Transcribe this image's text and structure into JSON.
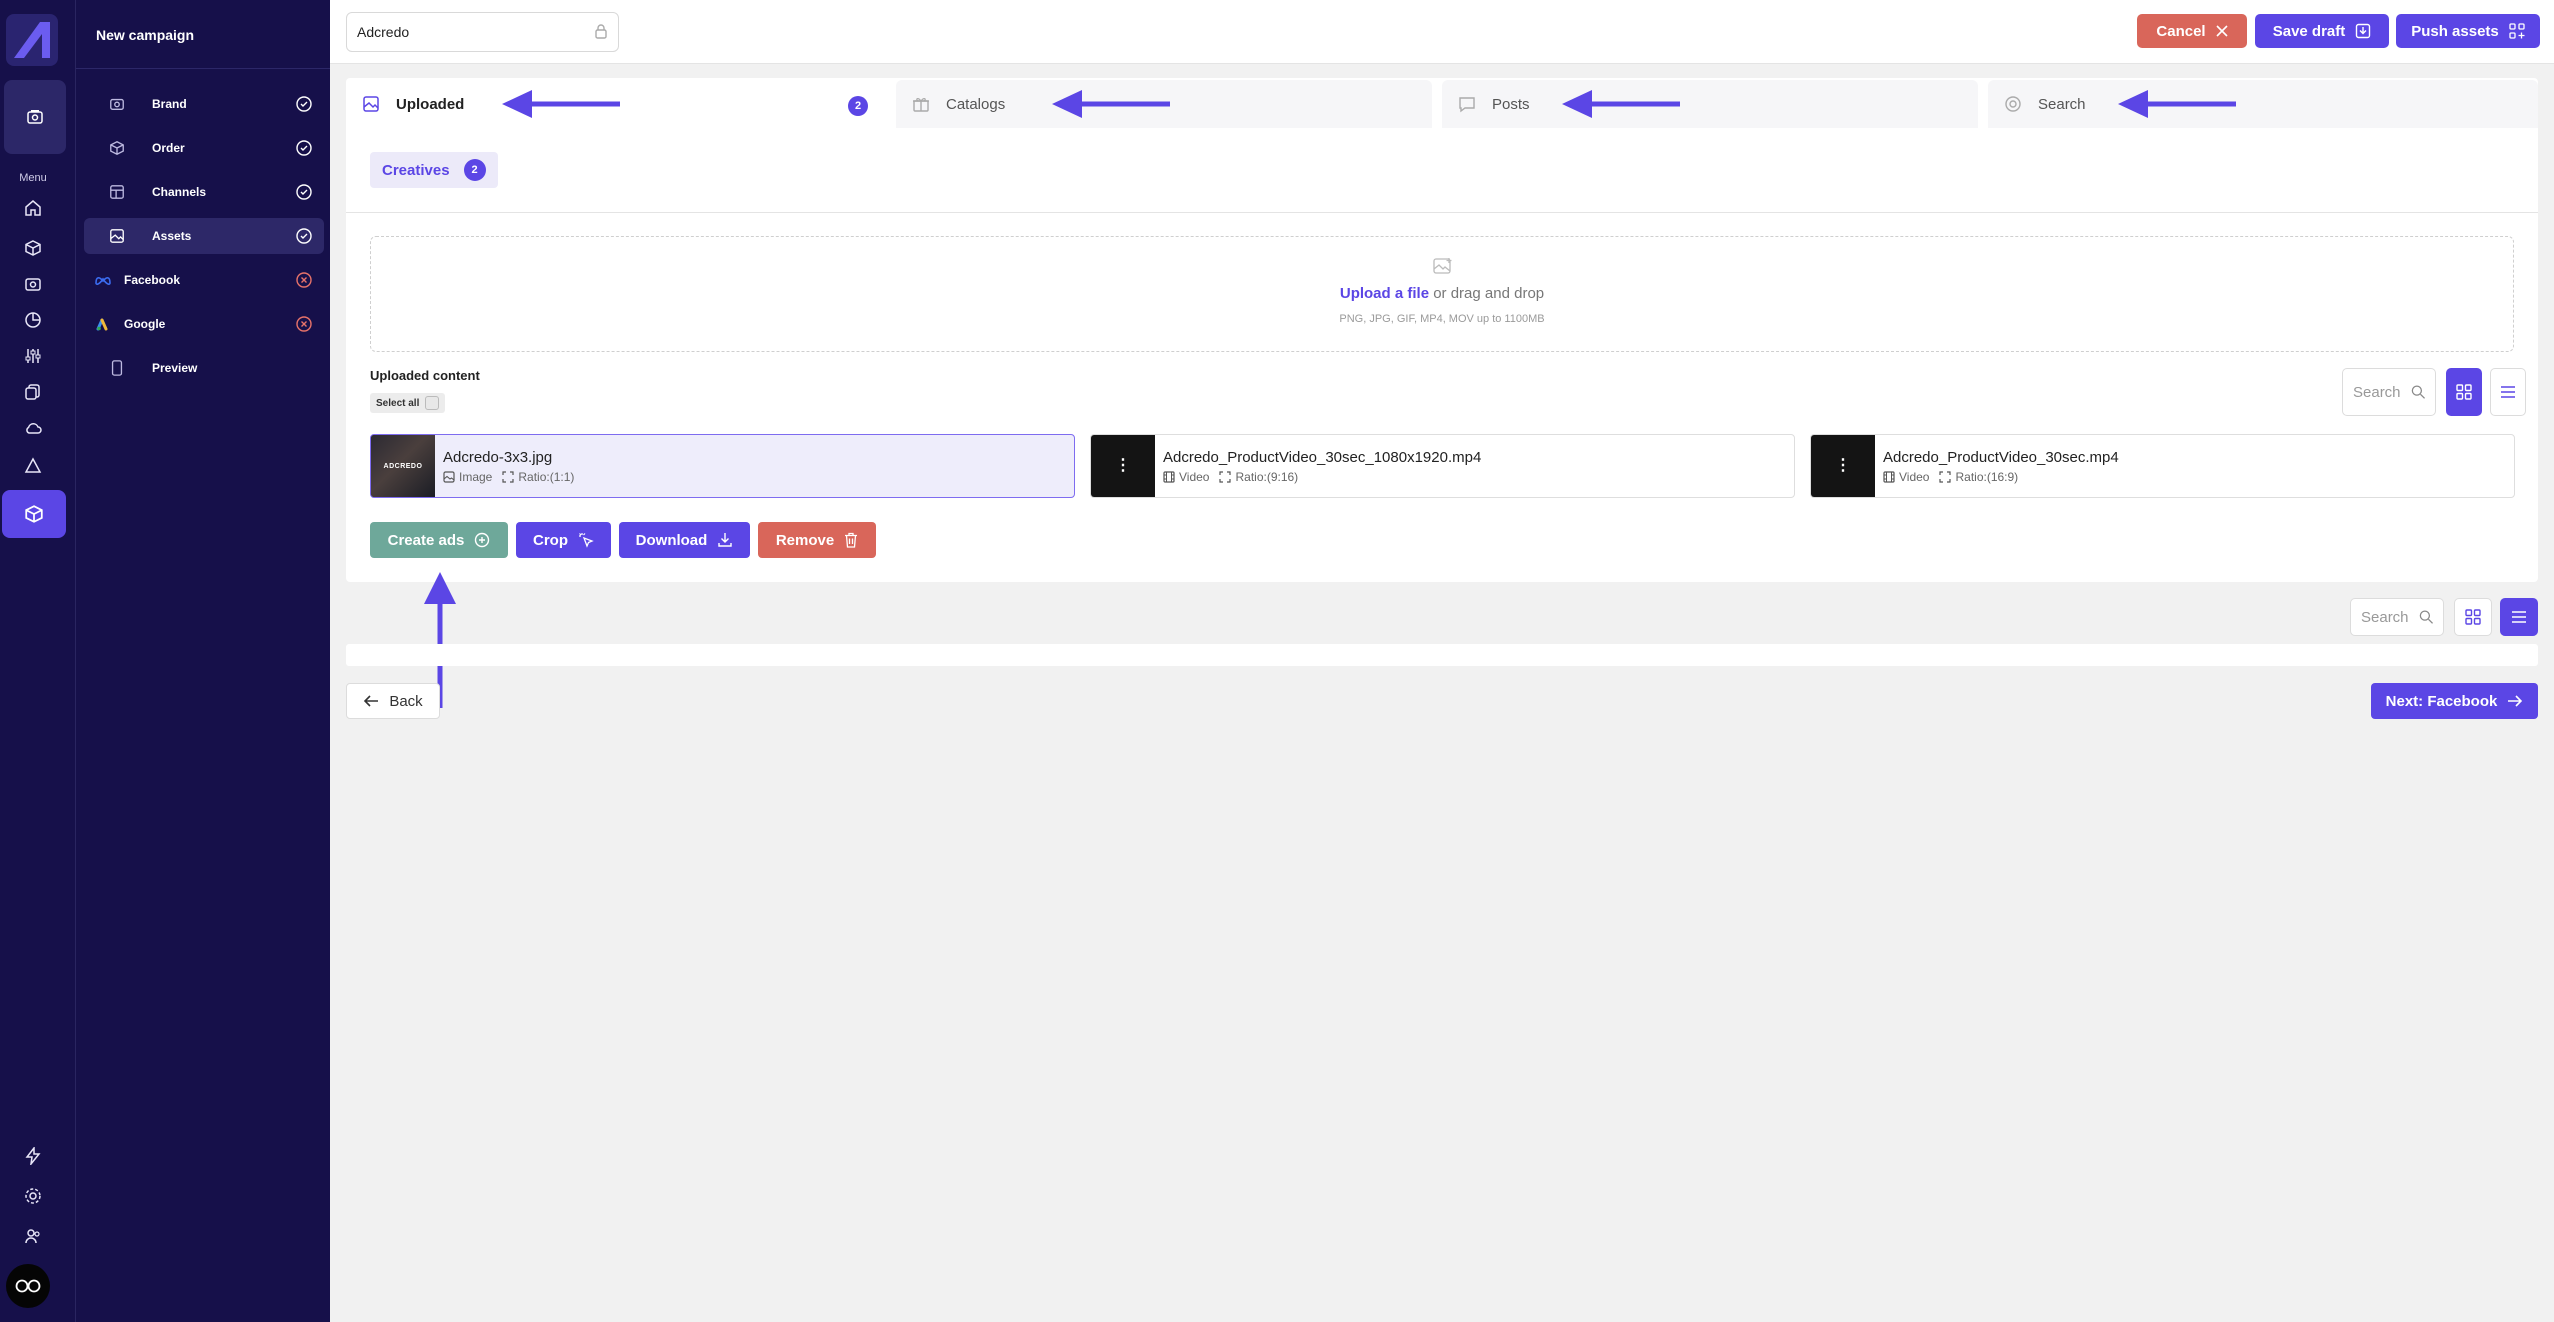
{
  "colors": {
    "brand_dark": "#16104a",
    "accent": "#5b46e5",
    "danger": "#d9665a",
    "success": "#6ea89a"
  },
  "rail": {
    "menu_label": "Menu",
    "icons": [
      "campaigns-icon",
      "home-icon",
      "box-icon",
      "camera-icon",
      "pie-chart-icon",
      "sliders-icon",
      "copy-icon",
      "cloud-icon",
      "alert-icon",
      "package-icon",
      "bolt-icon",
      "gear-icon",
      "users-icon"
    ]
  },
  "nav": {
    "title": "New campaign",
    "items": [
      {
        "label": "Brand",
        "status": "complete"
      },
      {
        "label": "Order",
        "status": "complete"
      },
      {
        "label": "Channels",
        "status": "complete"
      },
      {
        "label": "Assets",
        "status": "complete"
      },
      {
        "label": "Facebook",
        "status": "incomplete"
      },
      {
        "label": "Google",
        "status": "incomplete"
      },
      {
        "label": "Preview",
        "status": ""
      }
    ]
  },
  "topbar": {
    "campaign_name": "Adcredo",
    "cancel_label": "Cancel",
    "save_draft_label": "Save draft",
    "push_assets_label": "Push assets"
  },
  "tabs": [
    {
      "label": "Uploaded",
      "count": "2"
    },
    {
      "label": "Catalogs"
    },
    {
      "label": "Posts"
    },
    {
      "label": "Search"
    }
  ],
  "sub_tab": {
    "label": "Creatives",
    "count": "2"
  },
  "dropzone": {
    "link_text": "Upload a file",
    "rest_text": " or drag and drop",
    "hint": "PNG, JPG, GIF, MP4, MOV up to 1100MB"
  },
  "uploaded_content": {
    "label": "Uploaded content",
    "select_all": "Select all",
    "search_placeholder": "Search"
  },
  "assets": [
    {
      "name": "Adcredo-3x3.jpg",
      "type": "Image",
      "ratio": "Ratio:(1:1)",
      "thumb_text": "ADCREDO"
    },
    {
      "name": "Adcredo_ProductVideo_30sec_1080x1920.mp4",
      "type": "Video",
      "ratio": "Ratio:(9:16)"
    },
    {
      "name": "Adcredo_ProductVideo_30sec.mp4",
      "type": "Video",
      "ratio": "Ratio:(16:9)"
    }
  ],
  "actions": {
    "create_ads": "Create ads",
    "crop": "Crop",
    "download": "Download",
    "remove": "Remove"
  },
  "lower_search_placeholder": "Search",
  "footer": {
    "back_label": "Back",
    "next_label": "Next: Facebook"
  }
}
